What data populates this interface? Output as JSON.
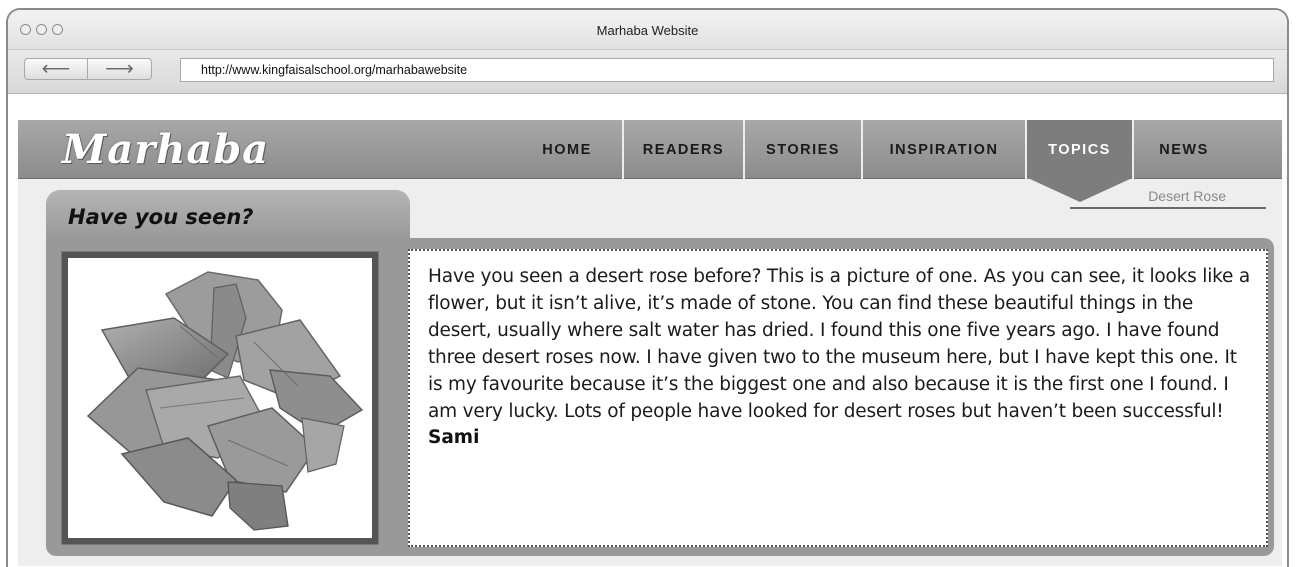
{
  "window": {
    "title": "Marhaba Website",
    "back_icon": "back-arrow-icon",
    "forward_icon": "forward-arrow-icon",
    "back_glyph": "⟵",
    "forward_glyph": "⟶",
    "url": "http://www.kingfaisalschool.org/marhabawebsite"
  },
  "site": {
    "logo": "Marhaba",
    "nav": [
      {
        "label": "HOME",
        "active": false
      },
      {
        "label": "READERS",
        "active": false
      },
      {
        "label": "STORIES",
        "active": false
      },
      {
        "label": "INSPIRATION",
        "active": false
      },
      {
        "label": "TOPICS",
        "active": true
      },
      {
        "label": "NEWS",
        "active": false
      }
    ],
    "subnav_label": "Desert Rose",
    "section_title": "Have you seen?",
    "article": {
      "image_subject": "desert rose stone",
      "text": "Have you seen a desert rose before? This is a picture of one. As you can see, it looks like a flower, but it isn’t alive, it’s made of stone. You can find these beautiful things in the desert, usually where salt water has dried. I found this one five years ago. I have found three desert roses now. I have given two to the museum here, but I have kept this one. It is my favourite because it’s the biggest one and also because it is the first one I found. I am very lucky. Lots of people have looked for desert roses but haven’t been successful!",
      "author": "Sami"
    }
  },
  "colors": {
    "header_gray": "#8c8c8c",
    "active_tab": "#7d7d7d",
    "panel_gray": "#999999"
  }
}
